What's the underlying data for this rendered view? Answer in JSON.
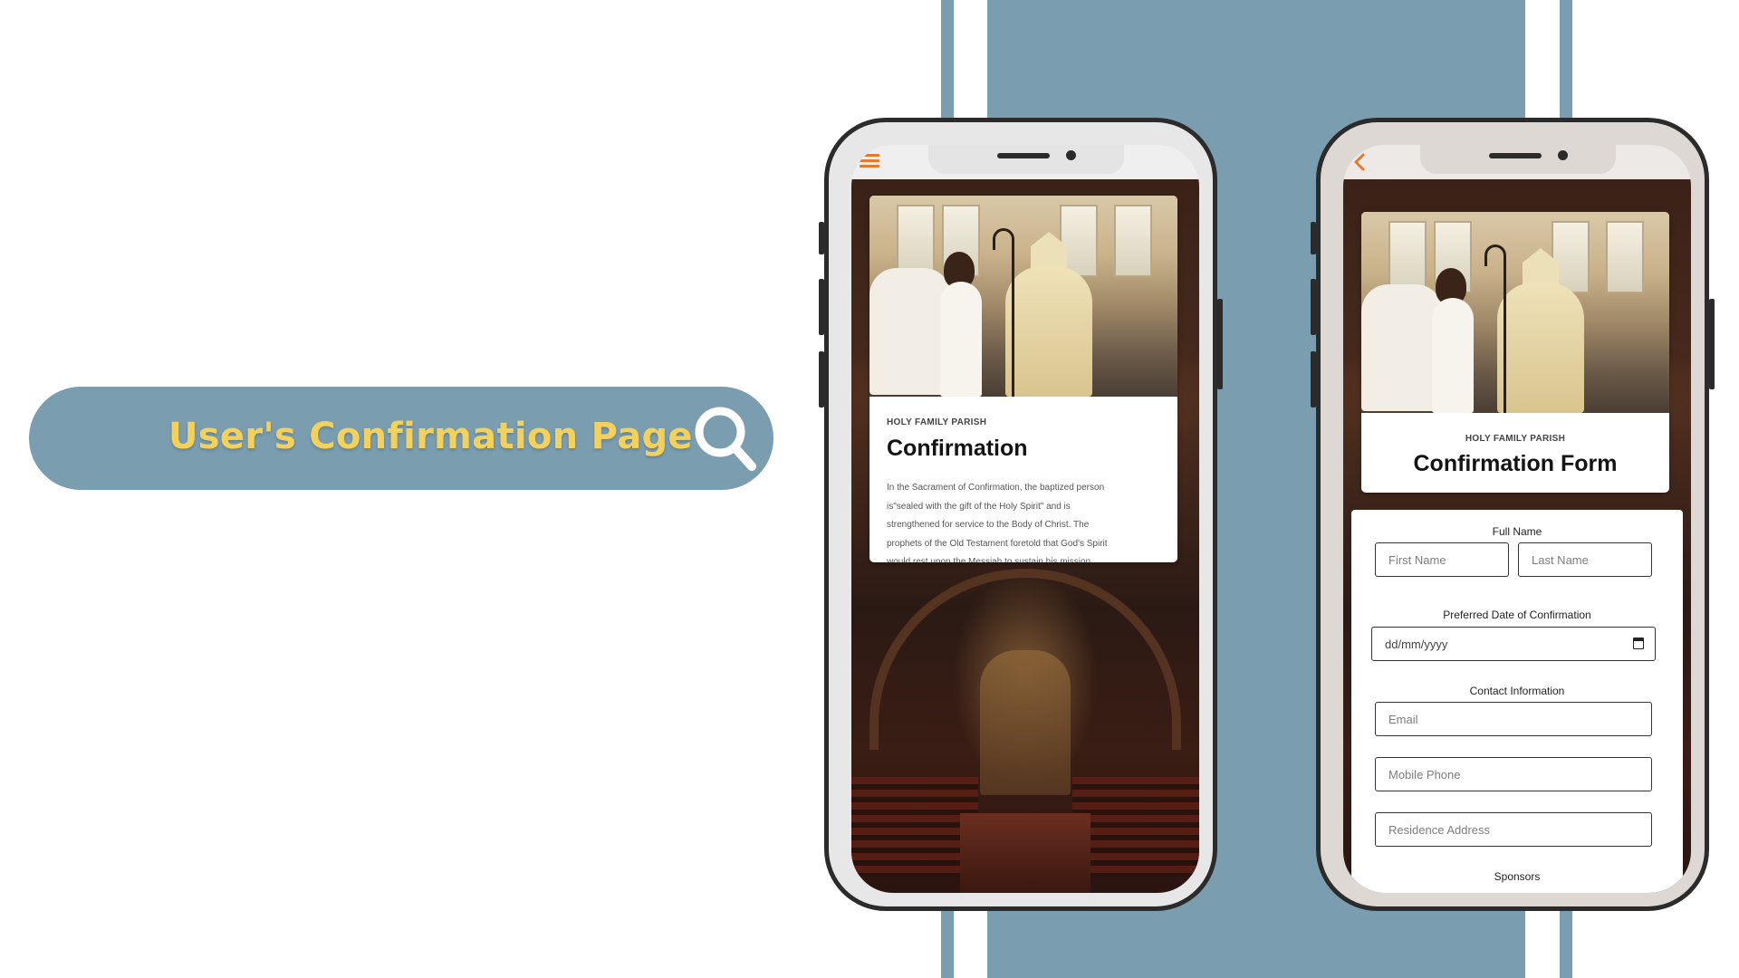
{
  "slide": {
    "title": "User's Confirmation Page",
    "title_color": "#f3d15a",
    "pill_color": "#7a9db0",
    "icon": "search-icon"
  },
  "screen1": {
    "menu_icon": "menu-icon",
    "parish": "HOLY FAMILY PARISH",
    "title": "Confirmation",
    "body_lines": [
      "In the Sacrament of Confirmation, the baptized person",
      "is\"sealed with the gift of the Holy Spirit\" and is",
      "strengthened for service to the Body of Christ. The",
      "prophets of the Old Testament foretold that God's Spirit",
      "would rest upon the Messiah to sustain his mission."
    ]
  },
  "screen2": {
    "back_icon": "back-icon",
    "parish": "HOLY FAMILY PARISH",
    "title": "Confirmation Form",
    "form": {
      "full_name_label": "Full Name",
      "first_name_placeholder": "First Name",
      "last_name_placeholder": "Last Name",
      "date_label": "Preferred Date of Confirmation",
      "date_placeholder": "dd/mm/yyyy",
      "contact_label": "Contact Information",
      "email_placeholder": "Email",
      "phone_placeholder": "Mobile Phone",
      "address_placeholder": "Residence Address",
      "sponsors_label": "Sponsors"
    }
  },
  "colors": {
    "accent": "#e37a2c",
    "stripe": "#7a9db0"
  }
}
